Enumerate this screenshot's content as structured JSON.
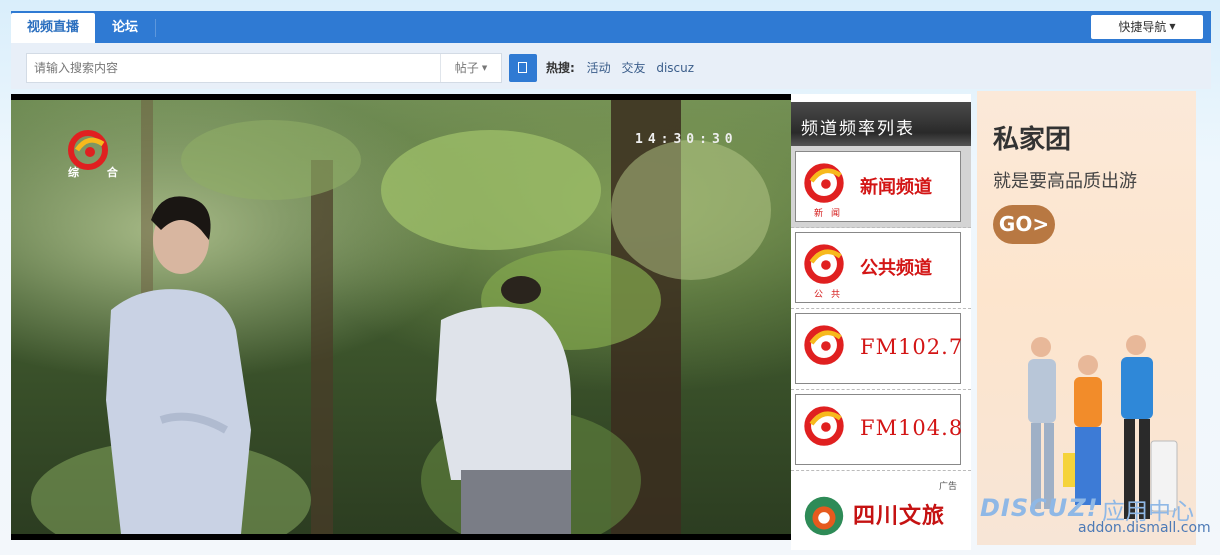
{
  "nav": {
    "tabs": [
      {
        "label": "视频直播"
      },
      {
        "label": "论坛"
      }
    ],
    "quick_nav_label": "快捷导航"
  },
  "search": {
    "placeholder": "请输入搜索内容",
    "type_label": "帖子",
    "hot_label": "热搜:",
    "hot_links": [
      "活动",
      "交友",
      "discuz"
    ]
  },
  "player": {
    "channel_logo_text": "综 合",
    "clock": "14:30:30"
  },
  "channels": {
    "title": "频道频率列表",
    "items": [
      {
        "name": "新闻频道",
        "sub": "新闻"
      },
      {
        "name": "公共频道",
        "sub": "公共"
      },
      {
        "name": "FM102.7",
        "sub": ""
      },
      {
        "name": "FM104.8",
        "sub": ""
      }
    ],
    "ad_label": "广告",
    "ad_name": "四川文旅"
  },
  "ad": {
    "title": "私家团",
    "subtitle": "就是要高品质出游",
    "button": "GO>"
  },
  "watermark": {
    "brand": "DISCUZ!",
    "cn": "应用中心",
    "url": "addon.dismall.com"
  },
  "colors": {
    "nav_blue": "#2f7ad3",
    "channel_red": "#d31515",
    "ad_button": "#b87842"
  }
}
